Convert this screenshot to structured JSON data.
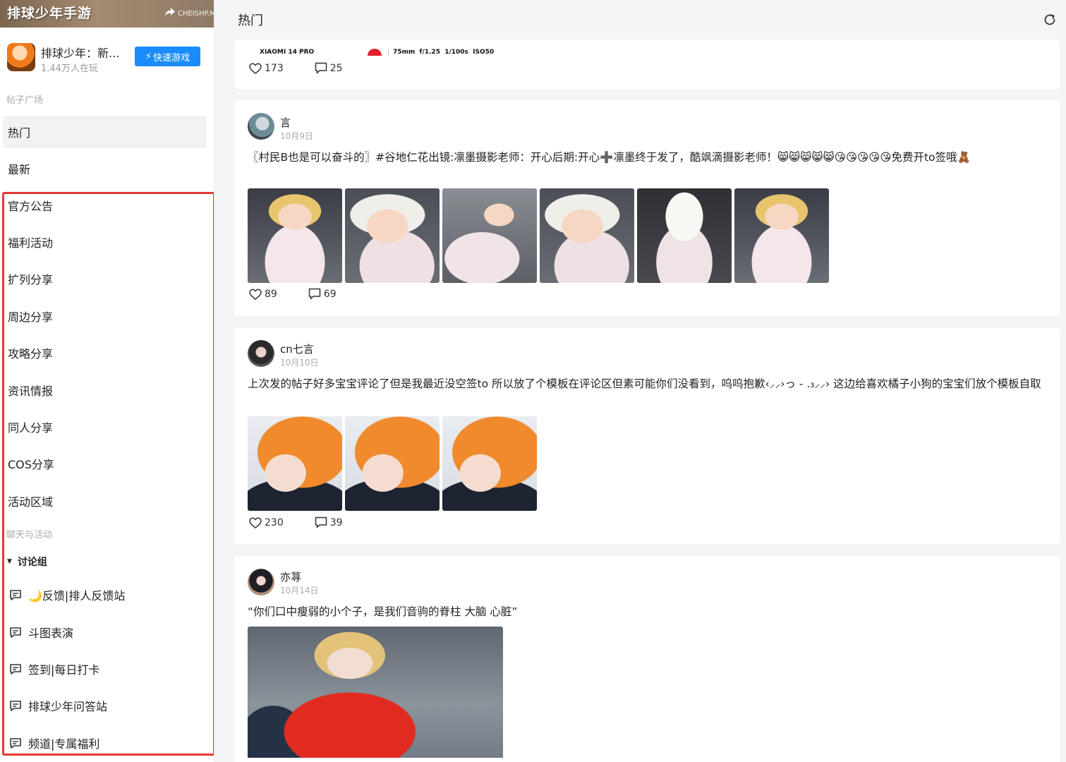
{
  "sidebar": {
    "banner_title": "排球少年手游",
    "banner_tag": "CHEISHP.M",
    "game": {
      "name": "排球少年：新...",
      "players": "1.44万人在玩",
      "quick_play_label": "快速游戏"
    },
    "section_posts": "帖子广场",
    "nav": [
      {
        "label": "热门",
        "active": true
      },
      {
        "label": "最新"
      },
      {
        "label": "官方公告"
      },
      {
        "label": "福利活动"
      },
      {
        "label": "扩列分享"
      },
      {
        "label": "周边分享"
      },
      {
        "label": "攻略分享"
      },
      {
        "label": "资讯情报"
      },
      {
        "label": "同人分享"
      },
      {
        "label": "COS分享"
      },
      {
        "label": "活动区域"
      }
    ],
    "section_chat": "聊天与活动",
    "group_label": "讨论组",
    "channels": [
      {
        "label": "🌙反馈|排人反馈站"
      },
      {
        "label": "斗图表演"
      },
      {
        "label": "签到|每日打卡"
      },
      {
        "label": "排球少年问答站"
      },
      {
        "label": "频道|专属福利"
      }
    ],
    "highlight_color": "#e53935"
  },
  "main": {
    "title": "热门",
    "posts": [
      {
        "exif_device": "XIAOMI 14 PRO",
        "exif_params": "75mm  f/1.25  1/100s  ISO50",
        "likes": "173",
        "comments": "25"
      },
      {
        "author": "言",
        "date": "10月9日",
        "text": "〖村民B也是可以奋斗的〗#谷地仁花出镜:凛墨摄影老师：开心后期:开心➕凛墨终于发了，酷飒滴摄影老师！😸😸😸😸😸😘😘😘😘😘免费开to签哦🧸",
        "likes": "89",
        "comments": "69"
      },
      {
        "author": "cn七言",
        "date": "10月10日",
        "text": "上次发的帖子好多宝宝评论了但是我最近没空签to 所以放了个模板在评论区但素可能你们没看到，呜呜抱歉‹⸝⸝›っ - .₃⸝⸝› 这边给喜欢橘子小狗的宝宝们放个模板自取",
        "likes": "230",
        "comments": "39"
      },
      {
        "author": "亦荨",
        "date": "10月14日",
        "text": "“你们口中瘦弱的小个子，是我们音驹的脊柱 大脑 心脏”"
      }
    ]
  },
  "colors": {
    "accent": "#1a8cff",
    "highlight": "#e53935"
  }
}
